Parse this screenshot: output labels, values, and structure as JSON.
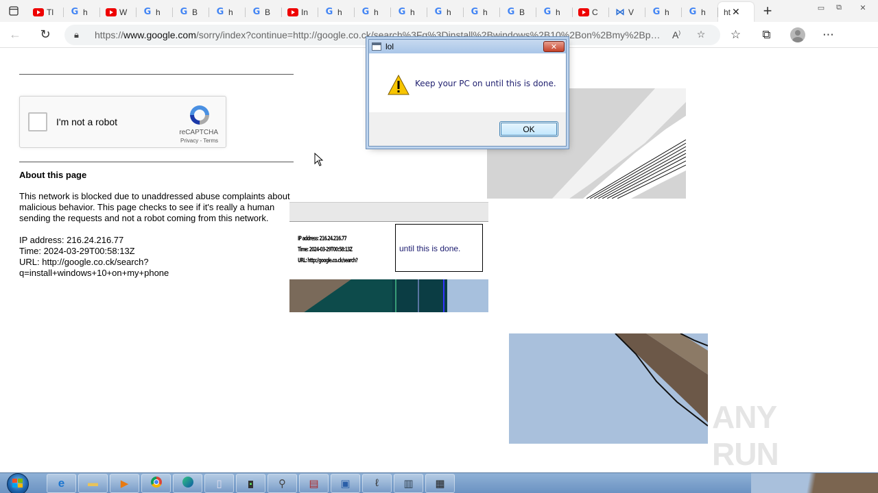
{
  "browser": {
    "tabs": [
      {
        "icon": "youtube",
        "label": "Tl"
      },
      {
        "icon": "google",
        "label": "h"
      },
      {
        "icon": "youtube",
        "label": "W"
      },
      {
        "icon": "google",
        "label": "h"
      },
      {
        "icon": "google",
        "label": "B"
      },
      {
        "icon": "google",
        "label": "h"
      },
      {
        "icon": "google",
        "label": "B"
      },
      {
        "icon": "youtube",
        "label": "In"
      },
      {
        "icon": "google",
        "label": "h"
      },
      {
        "icon": "google",
        "label": "h"
      },
      {
        "icon": "google",
        "label": "h"
      },
      {
        "icon": "google",
        "label": "h"
      },
      {
        "icon": "google",
        "label": "h"
      },
      {
        "icon": "google",
        "label": "B"
      },
      {
        "icon": "google",
        "label": "h"
      },
      {
        "icon": "youtube",
        "label": "C"
      },
      {
        "icon": "vs",
        "label": "V"
      },
      {
        "icon": "google",
        "label": "h"
      },
      {
        "icon": "google",
        "label": "h"
      }
    ],
    "active_tab": {
      "label": "ht"
    },
    "url": {
      "scheme": "https://",
      "host": "www.google.com",
      "path": "/sorry/index?continue=http://google.co.ck/search%3Fq%3Dinstall%2Bwindows%2B10%2Bon%2Bmy%2Bphone&q..."
    }
  },
  "page": {
    "captcha": {
      "label": "I'm not a robot",
      "brand": "reCAPTCHA",
      "links": "Privacy - Terms"
    },
    "about_title": "About this page",
    "paragraph": "This network is blocked due to unaddressed abuse complaints about malicious behavior. This page checks to see if it's really a human sending the requests and not a robot coming from this network.",
    "ip_line": "IP address: 216.24.216.77",
    "time_line": "Time: 2024-03-29T00:58:13Z",
    "url_line": "URL: http://google.co.ck/search?q=install+windows+10+on+my+phone"
  },
  "artifact": {
    "ip_line": "IP address: 216.24.216.77",
    "time_line": "Time: 2024-03-29T00:58:13Z",
    "url_line": "URL: http://google.co.ck/search?",
    "dialog_text": "until this is done."
  },
  "dialog": {
    "title": "lol",
    "message": "Keep your PC on until this is done.",
    "ok_label": "OK"
  },
  "watermark": "ANY RUN",
  "taskbar": {
    "items": [
      "internet-explorer-icon",
      "folder-icon",
      "media-player-icon",
      "chrome-icon",
      "edge-icon",
      "notepad-icon",
      "terminal-icon",
      "tool-icon",
      "archive-icon",
      "remote-desktop-icon",
      "recorder-icon",
      "document-icon",
      "calculator-icon"
    ]
  }
}
